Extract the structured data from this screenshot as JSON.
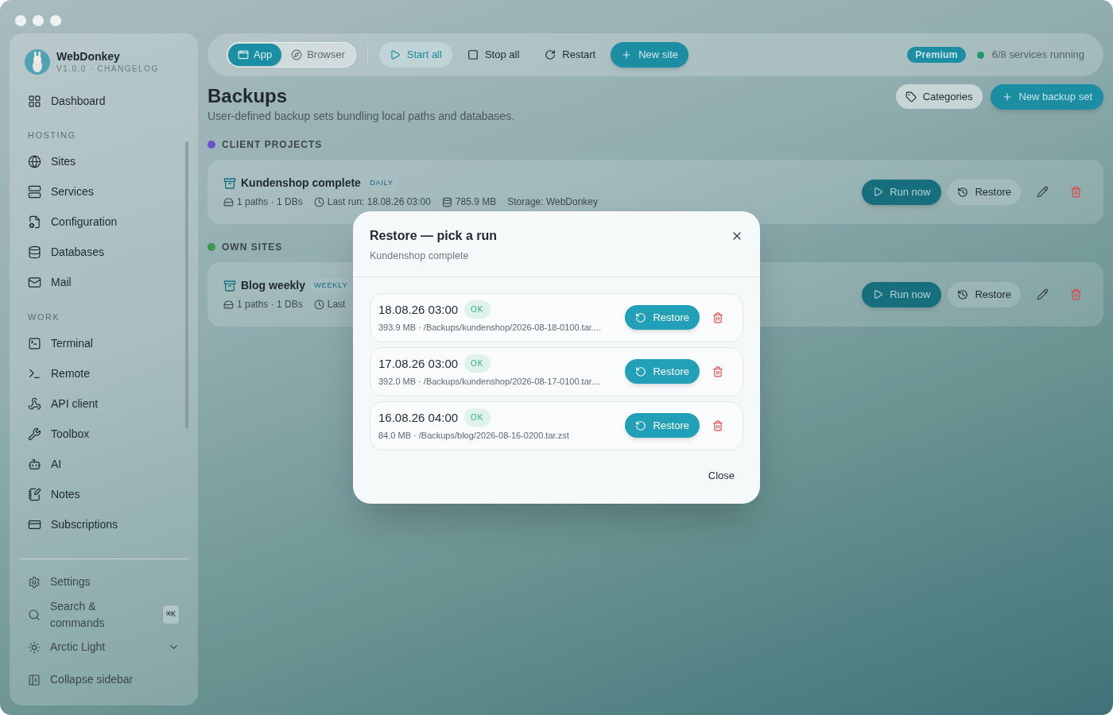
{
  "sidebar": {
    "app_name": "WebDonkey",
    "version_line": "V1.0.0 · CHANGELOG",
    "sections": [
      {
        "items": [
          {
            "label": "Dashboard"
          }
        ]
      },
      {
        "heading": "HOSTING",
        "items": [
          {
            "label": "Sites"
          },
          {
            "label": "Services"
          },
          {
            "label": "Configuration"
          },
          {
            "label": "Databases"
          },
          {
            "label": "Mail"
          }
        ]
      },
      {
        "heading": "WORK",
        "items": [
          {
            "label": "Terminal"
          },
          {
            "label": "Remote"
          },
          {
            "label": "API client"
          },
          {
            "label": "Toolbox"
          },
          {
            "label": "AI"
          },
          {
            "label": "Notes"
          },
          {
            "label": "Subscriptions"
          }
        ]
      }
    ],
    "footer": [
      {
        "label": "Settings"
      },
      {
        "label": "Search & commands",
        "shortcut": "⌘K"
      },
      {
        "label": "Arctic Light",
        "dropdown": true
      },
      {
        "label": "Collapse sidebar"
      }
    ]
  },
  "toolbar": {
    "views": [
      {
        "label": "App",
        "selected": true
      },
      {
        "label": "Browser",
        "selected": false
      }
    ],
    "actions": [
      {
        "label": "Start all",
        "kind": "accent"
      },
      {
        "label": "Stop all",
        "kind": "plain"
      },
      {
        "label": "Restart",
        "kind": "plain"
      },
      {
        "label": "New site",
        "kind": "primary"
      }
    ],
    "plan_badge": "Premium",
    "status": {
      "text": "6/8 services running",
      "color": "#1f9a6a"
    }
  },
  "page": {
    "title": "Backups",
    "subtitle": "User-defined backup sets bundling local paths and databases.",
    "categories_button": "Categories",
    "new_button": "New backup set",
    "groups": [
      {
        "name": "CLIENT PROJECTS",
        "color": "#6a4fd0",
        "sets": [
          {
            "name": "Kundenshop complete",
            "frequency": "DAILY",
            "meta": [
              "1 paths · 1 DBs",
              "Last run: 18.08.26 03:00",
              "785.9 MB",
              "Storage: WebDonkey"
            ],
            "run_now": "Run now",
            "restore": "Restore"
          }
        ]
      },
      {
        "name": "OWN SITES",
        "color": "#3a9a4a",
        "sets": [
          {
            "name": "Blog weekly",
            "frequency": "WEEKLY",
            "meta": [
              "1 paths · 1 DBs",
              "Last"
            ],
            "run_now": "Run now",
            "restore": "Restore"
          }
        ]
      }
    ]
  },
  "dialog": {
    "title": "Restore — pick a run",
    "subtitle": "Kundenshop complete",
    "runs": [
      {
        "date": "18.08.26 03:00",
        "status": "OK",
        "detail": "393.9 MB · /Backups/kundenshop/2026-08-18-0100.tar....",
        "restore_label": "Restore"
      },
      {
        "date": "17.08.26 03:00",
        "status": "OK",
        "detail": "392.0 MB · /Backups/kundenshop/2026-08-17-0100.tar....",
        "restore_label": "Restore"
      },
      {
        "date": "16.08.26 04:00",
        "status": "OK",
        "detail": "84.0 MB · /Backups/blog/2026-08-16-0200.tar.zst",
        "restore_label": "Restore"
      }
    ],
    "close": "Close"
  }
}
